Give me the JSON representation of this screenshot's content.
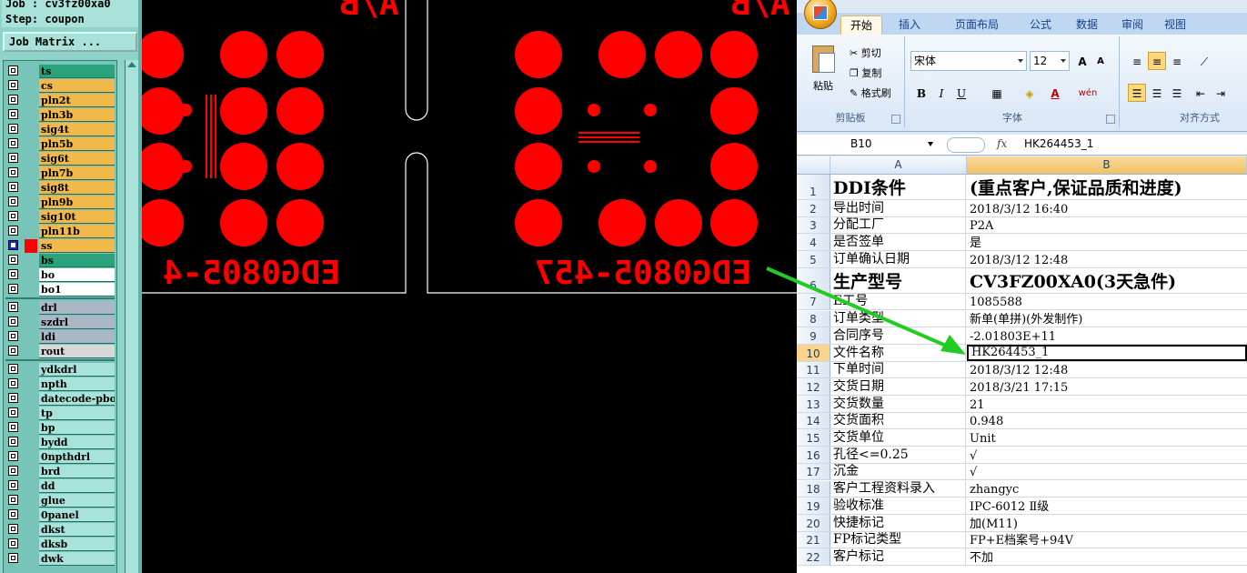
{
  "left_panel": {
    "job_label": "Job : cv3fz00xa0",
    "step_label": "Step: coupon",
    "job_matrix_button": "Job Matrix ...",
    "layers": [
      {
        "name": "ts",
        "color": "#2aa37a",
        "selected": false
      },
      {
        "name": "cs",
        "color": "#f2b94a",
        "selected": false
      },
      {
        "name": "pln2t",
        "color": "#f2b94a",
        "selected": false
      },
      {
        "name": "pln3b",
        "color": "#f2b94a",
        "selected": false
      },
      {
        "name": "sig4t",
        "color": "#f2b94a",
        "selected": false
      },
      {
        "name": "pln5b",
        "color": "#f2b94a",
        "selected": false
      },
      {
        "name": "sig6t",
        "color": "#f2b94a",
        "selected": false
      },
      {
        "name": "pln7b",
        "color": "#f2b94a",
        "selected": false
      },
      {
        "name": "sig8t",
        "color": "#f2b94a",
        "selected": false
      },
      {
        "name": "pln9b",
        "color": "#f2b94a",
        "selected": false
      },
      {
        "name": "sig10t",
        "color": "#f2b94a",
        "selected": false
      },
      {
        "name": "pln11b",
        "color": "#f2b94a",
        "selected": false
      },
      {
        "name": "ss",
        "color": "#f2b94a",
        "selected": true,
        "swatch": "#ff0000"
      },
      {
        "name": "bs",
        "color": "#2aa37a",
        "selected": false
      },
      {
        "name": "bo",
        "color": "#ffffff",
        "selected": false
      },
      {
        "name": "bo1",
        "color": "#ffffff",
        "selected": false
      },
      {
        "name": "drl",
        "color": "#a9b8c4",
        "selected": false,
        "group_start": true
      },
      {
        "name": "szdrl",
        "color": "#a9b8c4",
        "selected": false
      },
      {
        "name": "ldi",
        "color": "#a9b8c4",
        "selected": false
      },
      {
        "name": "rout",
        "color": "#d8d8d8",
        "selected": false
      },
      {
        "name": "ydkdrl",
        "color": "#a8e2d8",
        "selected": false,
        "group_start": true
      },
      {
        "name": "npth",
        "color": "#a8e2d8",
        "selected": false
      },
      {
        "name": "datecode-pbo",
        "color": "#a8e2d8",
        "selected": false
      },
      {
        "name": "tp",
        "color": "#a8e2d8",
        "selected": false
      },
      {
        "name": "bp",
        "color": "#a8e2d8",
        "selected": false
      },
      {
        "name": "bydd",
        "color": "#a8e2d8",
        "selected": false
      },
      {
        "name": "0npthdrl",
        "color": "#a8e2d8",
        "selected": false
      },
      {
        "name": "brd",
        "color": "#a8e2d8",
        "selected": false
      },
      {
        "name": "dd",
        "color": "#a8e2d8",
        "selected": false
      },
      {
        "name": "glue",
        "color": "#a8e2d8",
        "selected": false
      },
      {
        "name": "0panel",
        "color": "#a8e2d8",
        "selected": false
      },
      {
        "name": "dkst",
        "color": "#a8e2d8",
        "selected": false
      },
      {
        "name": "dksb",
        "color": "#a8e2d8",
        "selected": false
      },
      {
        "name": "dwk",
        "color": "#a8e2d8",
        "selected": false
      }
    ]
  },
  "canvas": {
    "text_left_top": "A/B",
    "text_right_top": "A/B",
    "text_left_bottom": "EDG0805-4",
    "text_right_bottom": "EDG0805-457",
    "pad_color": "#ff0000"
  },
  "excel": {
    "tabs": [
      "开始",
      "插入",
      "页面布局",
      "公式",
      "数据",
      "审阅",
      "视图"
    ],
    "active_tab": "开始",
    "clipboard": {
      "paste": "粘贴",
      "cut": "剪切",
      "copy": "复制",
      "format_painter": "格式刷",
      "group": "剪贴板"
    },
    "font": {
      "name": "宋体",
      "size": "12",
      "group": "字体",
      "bold": "B",
      "italic": "I",
      "underline": "U",
      "phonetic": "wén",
      "font_color": "A",
      "grow": "A",
      "shrink": "A"
    },
    "align": {
      "group": "对齐方式"
    },
    "name_box": "B10",
    "fx": "fx",
    "formula": "HK264453_1",
    "col_a": "A",
    "col_b": "B",
    "rows": [
      {
        "n": "1",
        "a": "DDI条件",
        "b": "(重点客户,保证品质和进度)",
        "big": true
      },
      {
        "n": "2",
        "a": "导出时间",
        "b": "2018/3/12 16:40"
      },
      {
        "n": "3",
        "a": "分配工厂",
        "b": "P2A"
      },
      {
        "n": "4",
        "a": "是否签单",
        "b": "是"
      },
      {
        "n": "5",
        "a": "订单确认日期",
        "b": "2018/3/12 12:48"
      },
      {
        "n": "6",
        "a": "生产型号",
        "b": "CV3FZ00XA0(3天急件)",
        "big": true
      },
      {
        "n": "7",
        "a": "E工号",
        "b": "1085588"
      },
      {
        "n": "8",
        "a": "订单类型",
        "b": "新单(单拼)(外发制作)"
      },
      {
        "n": "9",
        "a": "合同序号",
        "b": "-2.01803E+11"
      },
      {
        "n": "10",
        "a": "文件名称",
        "b": "HK264453_1",
        "active": true
      },
      {
        "n": "11",
        "a": "下单时间",
        "b": "2018/3/12 12:48"
      },
      {
        "n": "12",
        "a": "交货日期",
        "b": "2018/3/21 17:15"
      },
      {
        "n": "13",
        "a": "交货数量",
        "b": "21"
      },
      {
        "n": "14",
        "a": "交货面积",
        "b": "0.948"
      },
      {
        "n": "15",
        "a": "交货单位",
        "b": "Unit"
      },
      {
        "n": "16",
        "a": "孔径<=0.25",
        "b": "√"
      },
      {
        "n": "17",
        "a": "沉金",
        "b": "√"
      },
      {
        "n": "18",
        "a": "客户工程资料录入",
        "b": "zhangyc"
      },
      {
        "n": "19",
        "a": "验收标准",
        "b": "IPC-6012 Ⅱ级"
      },
      {
        "n": "20",
        "a": "快捷标记",
        "b": "加(M11)"
      },
      {
        "n": "21",
        "a": "FP标记类型",
        "b": "FP+E档案号+94V"
      },
      {
        "n": "22",
        "a": "客户标记",
        "b": "不加"
      }
    ]
  },
  "annotation_arrow_color": "#22cc22"
}
